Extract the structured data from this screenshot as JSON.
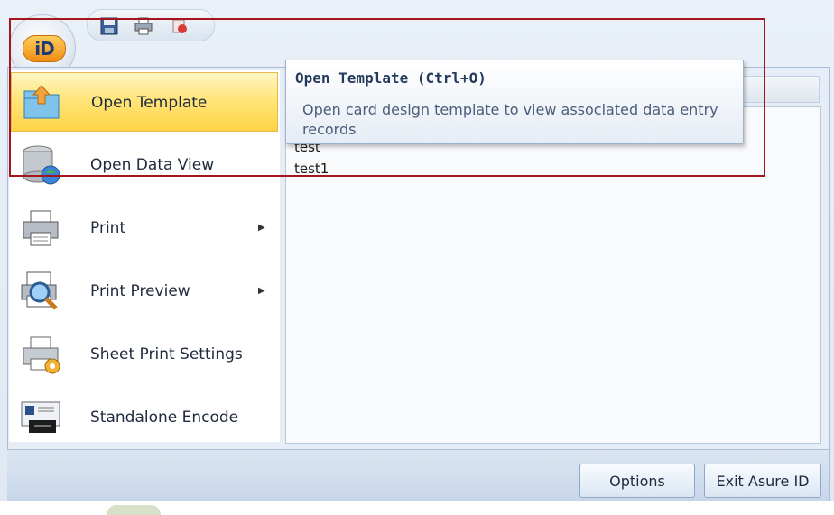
{
  "menu": {
    "items": [
      {
        "label": "Open Template",
        "selected": true,
        "icon": "open-template-icon"
      },
      {
        "label": "Open Data View",
        "selected": false,
        "icon": "data-view-icon"
      },
      {
        "label": "Print",
        "selected": false,
        "icon": "printer-icon",
        "submenu": true
      },
      {
        "label": "Print Preview",
        "selected": false,
        "icon": "print-preview-icon",
        "submenu": true
      },
      {
        "label": "Sheet Print Settings",
        "selected": false,
        "icon": "sheet-print-settings-icon"
      },
      {
        "label": "Standalone Encode",
        "selected": false,
        "icon": "encode-icon"
      }
    ],
    "recent": [
      "test",
      "test1"
    ]
  },
  "tooltip": {
    "title": "Open Template (Ctrl+O)",
    "description": "Open card design template to view associated data entry records"
  },
  "buttons": {
    "options": "Options",
    "exit": "Exit Asure ID"
  },
  "logo": {
    "text": "iD"
  },
  "colors": {
    "accent_highlight": "#a4151d",
    "selected_item": "#ffe57a",
    "panel_bg": "#e6edf6"
  }
}
